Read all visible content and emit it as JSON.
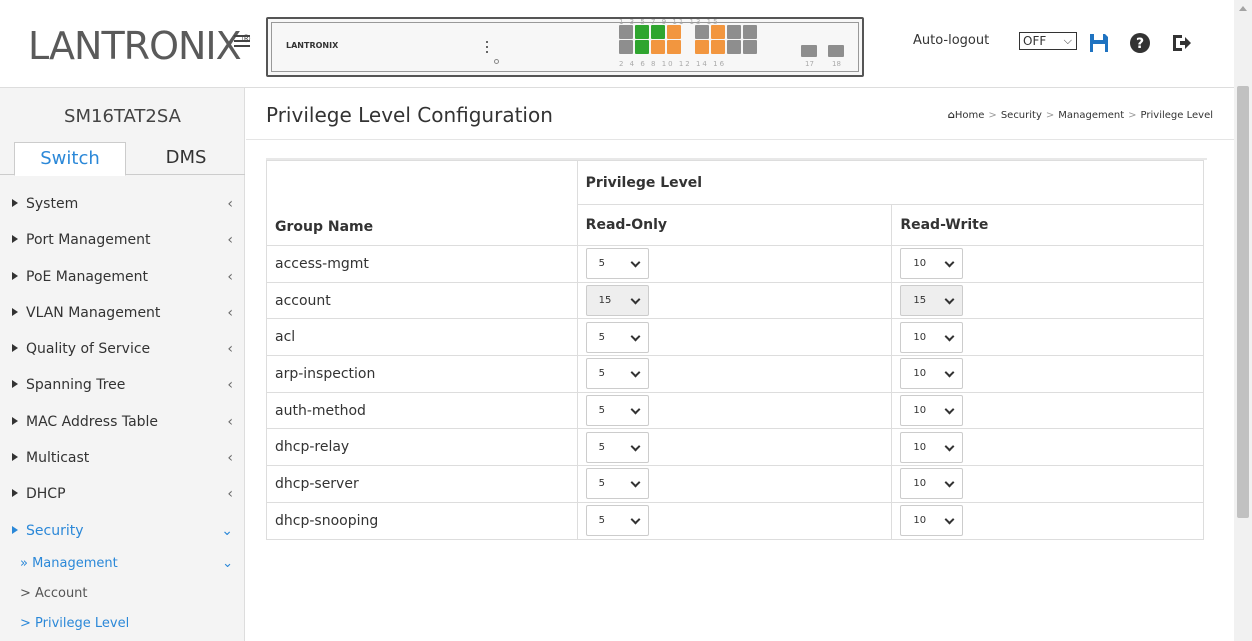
{
  "header": {
    "logo_main": "LANTRONIX",
    "logo_reg": "®",
    "panel_brand": "LANTRONIX",
    "port_numbers_top": "1 3 5 7 9 11 13 15",
    "port_numbers_bottom": "2 4 6 8 10 12 14 16",
    "sfp_labels": [
      "17",
      "18"
    ],
    "autologout_label": "Auto-logout",
    "autologout_value": "OFF",
    "icons": [
      "save-icon",
      "help-icon",
      "logout-icon"
    ],
    "accent_color": "#1f73c1"
  },
  "sidebar": {
    "device_name": "SM16TAT2SA",
    "tabs": [
      "Switch",
      "DMS"
    ],
    "items": [
      {
        "label": "System"
      },
      {
        "label": "Port Management"
      },
      {
        "label": "PoE Management"
      },
      {
        "label": "VLAN Management"
      },
      {
        "label": "Quality of Service"
      },
      {
        "label": "Spanning Tree"
      },
      {
        "label": "MAC Address Table"
      },
      {
        "label": "Multicast"
      },
      {
        "label": "DHCP"
      },
      {
        "label": "Security"
      }
    ],
    "sub_label": "» Management",
    "subsub": [
      "> Account",
      "> Privilege Level"
    ]
  },
  "main": {
    "title": "Privilege Level Configuration",
    "breadcrumb": [
      "Home",
      "Security",
      "Management",
      "Privilege Level"
    ],
    "table": {
      "header_group": "Group Name",
      "header_privilege": "Privilege Level",
      "header_ro": "Read-Only",
      "header_rw": "Read-Write",
      "rows": [
        {
          "name": "access-mgmt",
          "ro": "5",
          "rw": "10"
        },
        {
          "name": "account",
          "ro": "15",
          "rw": "15"
        },
        {
          "name": "acl",
          "ro": "5",
          "rw": "10"
        },
        {
          "name": "arp-inspection",
          "ro": "5",
          "rw": "10"
        },
        {
          "name": "auth-method",
          "ro": "5",
          "rw": "10"
        },
        {
          "name": "dhcp-relay",
          "ro": "5",
          "rw": "10"
        },
        {
          "name": "dhcp-server",
          "ro": "5",
          "rw": "10"
        },
        {
          "name": "dhcp-snooping",
          "ro": "5",
          "rw": "10"
        }
      ]
    }
  }
}
